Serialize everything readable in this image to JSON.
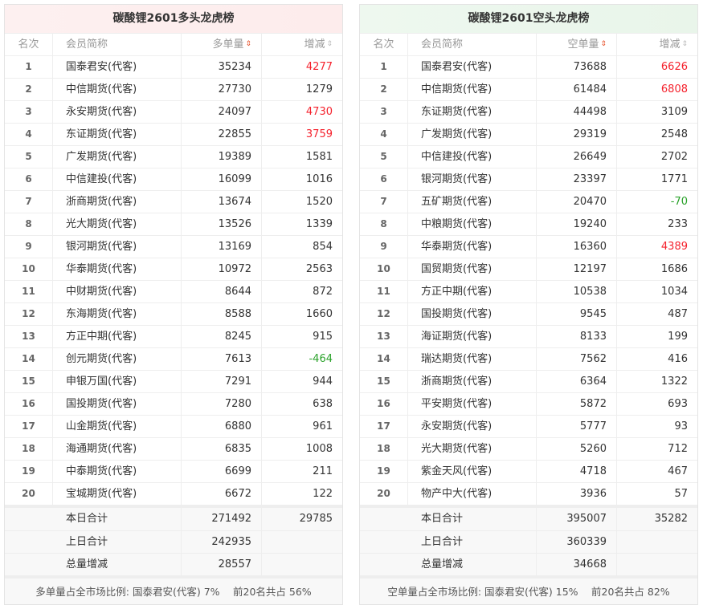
{
  "left": {
    "title": "碳酸锂2601多头龙虎榜",
    "headers": {
      "rank": "名次",
      "member": "会员简称",
      "volume": "多单量",
      "change": "增减"
    },
    "rows": [
      [
        "1",
        "国泰君安(代客)",
        "35234",
        "4277",
        "red"
      ],
      [
        "2",
        "中信期货(代客)",
        "27730",
        "1279",
        ""
      ],
      [
        "3",
        "永安期货(代客)",
        "24097",
        "4730",
        "red"
      ],
      [
        "4",
        "东证期货(代客)",
        "22855",
        "3759",
        "red"
      ],
      [
        "5",
        "广发期货(代客)",
        "19389",
        "1581",
        ""
      ],
      [
        "6",
        "中信建投(代客)",
        "16099",
        "1016",
        ""
      ],
      [
        "7",
        "浙商期货(代客)",
        "13674",
        "1520",
        ""
      ],
      [
        "8",
        "光大期货(代客)",
        "13526",
        "1339",
        ""
      ],
      [
        "9",
        "银河期货(代客)",
        "13169",
        "854",
        ""
      ],
      [
        "10",
        "华泰期货(代客)",
        "10972",
        "2563",
        ""
      ],
      [
        "11",
        "中财期货(代客)",
        "8644",
        "872",
        ""
      ],
      [
        "12",
        "东海期货(代客)",
        "8588",
        "1660",
        ""
      ],
      [
        "13",
        "方正中期(代客)",
        "8245",
        "915",
        ""
      ],
      [
        "14",
        "创元期货(代客)",
        "7613",
        "-464",
        "green"
      ],
      [
        "15",
        "申银万国(代客)",
        "7291",
        "944",
        ""
      ],
      [
        "16",
        "国投期货(代客)",
        "7280",
        "638",
        ""
      ],
      [
        "17",
        "山金期货(代客)",
        "6880",
        "961",
        ""
      ],
      [
        "18",
        "海通期货(代客)",
        "6835",
        "1008",
        ""
      ],
      [
        "19",
        "中泰期货(代客)",
        "6699",
        "211",
        ""
      ],
      [
        "20",
        "宝城期货(代客)",
        "6672",
        "122",
        ""
      ]
    ],
    "summary": [
      [
        "本日合计",
        "271492",
        "29785"
      ],
      [
        "上日合计",
        "242935",
        ""
      ],
      [
        "总量增减",
        "28557",
        ""
      ]
    ],
    "footer": "多单量占全市场比例: 国泰君安(代客) 7%　 前20名共占 56%"
  },
  "right": {
    "title": "碳酸锂2601空头龙虎榜",
    "headers": {
      "rank": "名次",
      "member": "会员简称",
      "volume": "空单量",
      "change": "增减"
    },
    "rows": [
      [
        "1",
        "国泰君安(代客)",
        "73688",
        "6626",
        "red"
      ],
      [
        "2",
        "中信期货(代客)",
        "61484",
        "6808",
        "red"
      ],
      [
        "3",
        "东证期货(代客)",
        "44498",
        "3109",
        ""
      ],
      [
        "4",
        "广发期货(代客)",
        "29319",
        "2548",
        ""
      ],
      [
        "5",
        "中信建投(代客)",
        "26649",
        "2702",
        ""
      ],
      [
        "6",
        "银河期货(代客)",
        "23397",
        "1771",
        ""
      ],
      [
        "7",
        "五矿期货(代客)",
        "20470",
        "-70",
        "green"
      ],
      [
        "8",
        "中粮期货(代客)",
        "19240",
        "233",
        ""
      ],
      [
        "9",
        "华泰期货(代客)",
        "16360",
        "4389",
        "red"
      ],
      [
        "10",
        "国贸期货(代客)",
        "12197",
        "1686",
        ""
      ],
      [
        "11",
        "方正中期(代客)",
        "10538",
        "1034",
        ""
      ],
      [
        "12",
        "国投期货(代客)",
        "9545",
        "487",
        ""
      ],
      [
        "13",
        "海证期货(代客)",
        "8133",
        "199",
        ""
      ],
      [
        "14",
        "瑞达期货(代客)",
        "7562",
        "416",
        ""
      ],
      [
        "15",
        "浙商期货(代客)",
        "6364",
        "1322",
        ""
      ],
      [
        "16",
        "平安期货(代客)",
        "5872",
        "693",
        ""
      ],
      [
        "17",
        "永安期货(代客)",
        "5777",
        "93",
        ""
      ],
      [
        "18",
        "光大期货(代客)",
        "5260",
        "712",
        ""
      ],
      [
        "19",
        "紫金天风(代客)",
        "4718",
        "467",
        ""
      ],
      [
        "20",
        "物产中大(代客)",
        "3936",
        "57",
        ""
      ]
    ],
    "summary": [
      [
        "本日合计",
        "395007",
        "35282"
      ],
      [
        "上日合计",
        "360339",
        ""
      ],
      [
        "总量增减",
        "34668",
        ""
      ]
    ],
    "footer": "空单量占全市场比例: 国泰君安(代客) 15%　 前20名共占 82%"
  },
  "colors": {
    "up": "#f5222d",
    "down": "#2aa22a",
    "sort_active": "#e8542e"
  }
}
